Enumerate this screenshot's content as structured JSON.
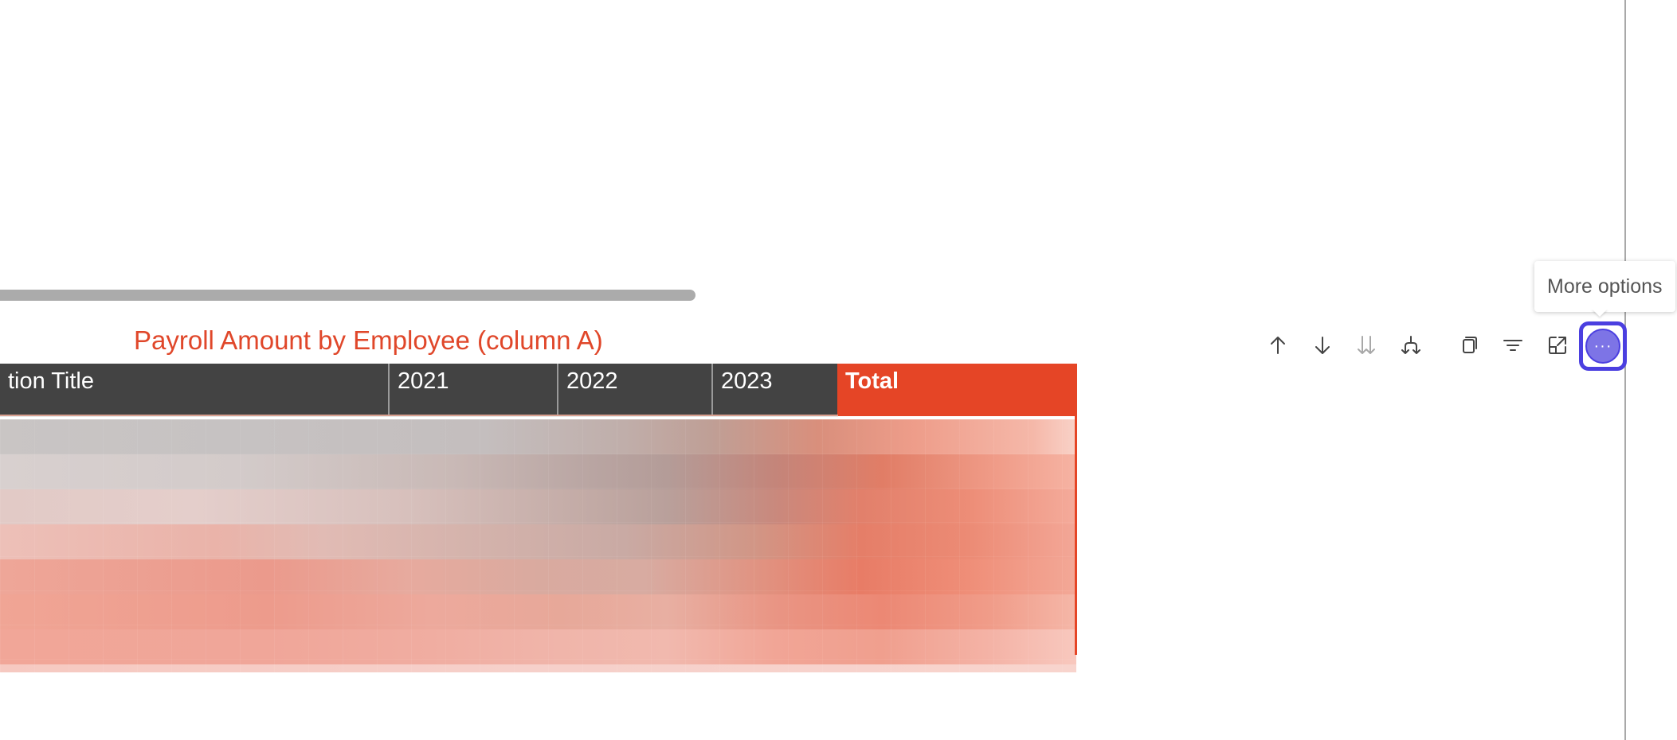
{
  "visual": {
    "title": "Payroll Amount by Employee (column A)",
    "title_color": "#e0472a",
    "header": {
      "columns": [
        "tion Title",
        "2021",
        "2022",
        "2023",
        "Total"
      ],
      "header_bg": "#434343",
      "total_bg": "#e54526"
    }
  },
  "toolbar": {
    "buttons": [
      {
        "name": "drill-up",
        "icon": "arrow-up-icon"
      },
      {
        "name": "drill-down",
        "icon": "arrow-down-icon"
      },
      {
        "name": "go-to-next-level",
        "icon": "double-arrow-down-icon"
      },
      {
        "name": "expand-next-level",
        "icon": "fork-down-icon"
      },
      {
        "name": "copy-visual",
        "icon": "copy-icon"
      },
      {
        "name": "filter",
        "icon": "filter-icon"
      },
      {
        "name": "focus-mode",
        "icon": "focus-mode-icon"
      },
      {
        "name": "more-options",
        "icon": "ellipsis-icon"
      }
    ],
    "accent": "#4b3fe0"
  },
  "tooltip": {
    "text": "More options"
  }
}
